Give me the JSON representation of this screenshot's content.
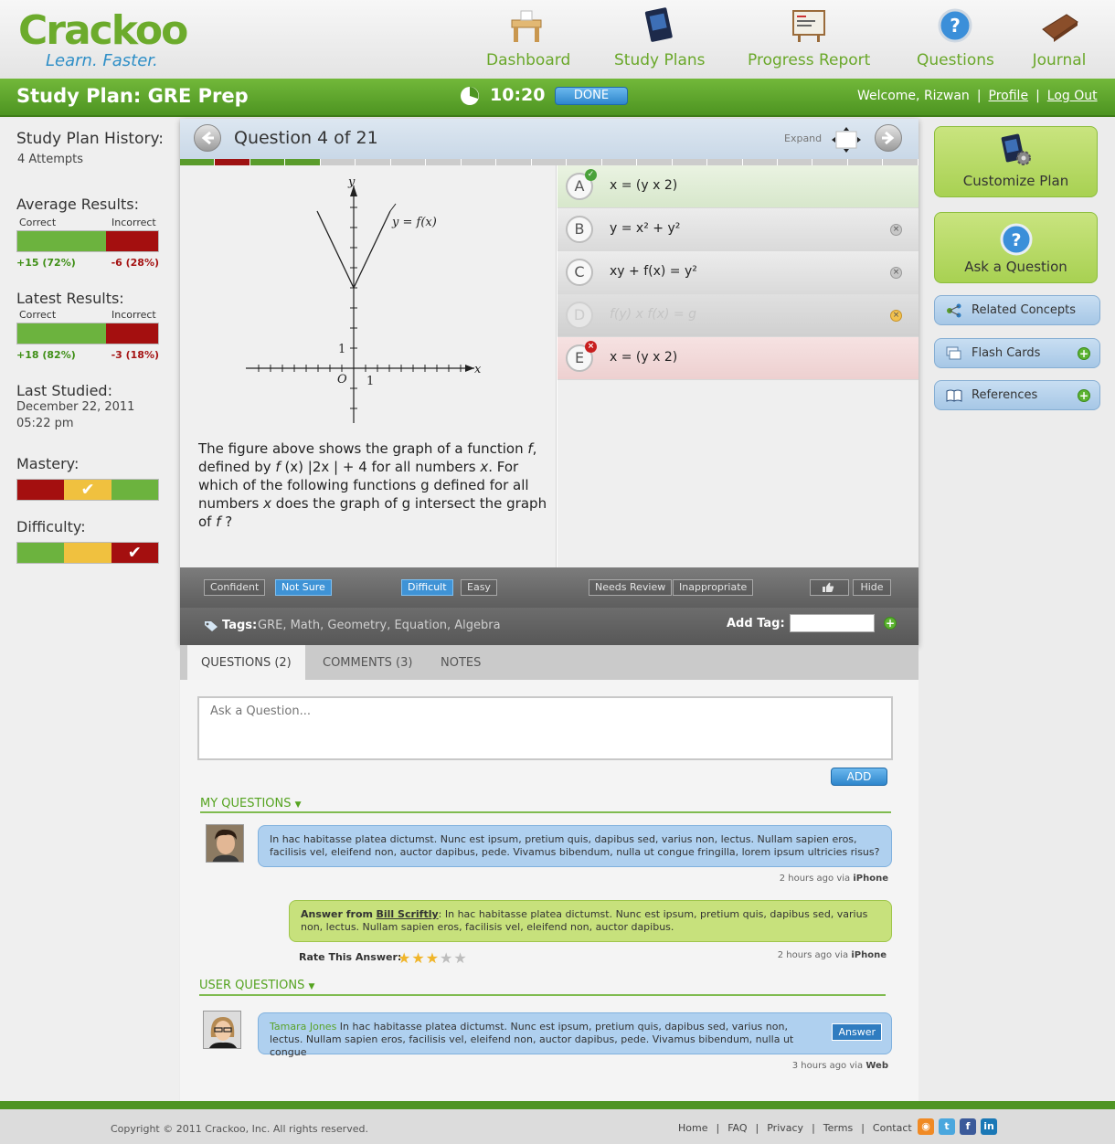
{
  "brand": {
    "name": "Crackoo",
    "tagline": "Learn. Faster.",
    "green": "#6cab2c",
    "blue": "#2f8fc7"
  },
  "nav": [
    {
      "label": "Dashboard",
      "icon": "desk-icon"
    },
    {
      "label": "Study Plans",
      "icon": "book-icon"
    },
    {
      "label": "Progress Report",
      "icon": "report-board-icon"
    },
    {
      "label": "Questions",
      "icon": "question-mark-icon"
    },
    {
      "label": "Journal",
      "icon": "journal-icon"
    }
  ],
  "topbar": {
    "plan_title": "Study Plan: GRE Prep",
    "timer": "10:20",
    "done_label": "DONE",
    "welcome": "Welcome, Rizwan",
    "profile": "Profile",
    "logout": "Log Out",
    "sep": "|"
  },
  "sidebar": {
    "history_title": "Study Plan History:",
    "attempts": "4 Attempts",
    "average_title": "Average Results:",
    "latest_title": "Latest Results:",
    "correct_label": "Correct",
    "incorrect_label": "Incorrect",
    "average": {
      "correct": "+15 (72%)",
      "incorrect": "-6 (28%)",
      "correct_fraction": 0.63
    },
    "latest": {
      "correct": "+18 (82%)",
      "incorrect": "-3 (18%)",
      "correct_fraction": 0.63
    },
    "last_studied_title": "Last Studied:",
    "last_studied_date": "December 22, 2011",
    "last_studied_time": "05:22 pm",
    "mastery_title": "Mastery:",
    "mastery_colors": [
      "#a40f0f",
      "#f0c13f",
      "#6cb33e"
    ],
    "mastery_checked": 2,
    "difficulty_title": "Difficulty:",
    "difficulty_colors": [
      "#6cb33e",
      "#f0c13f",
      "#a40f0f"
    ],
    "difficulty_checked": 3
  },
  "question": {
    "title": "Question 4 of 21",
    "expand": "Expand",
    "progress": [
      "g",
      "r",
      "g",
      "g",
      "n",
      "n",
      "n",
      "n",
      "n",
      "n",
      "n",
      "n",
      "n",
      "n",
      "n",
      "n",
      "n",
      "n",
      "n",
      "n",
      "n"
    ],
    "graph": {
      "y_axis_label": "y",
      "x_axis_label": "x",
      "curve_label": "y = f(x)",
      "origin_label": "O",
      "one_x": "1",
      "one_y": "1"
    },
    "text_parts": {
      "p1": "The figure above shows the graph of a function ",
      "f1": "f",
      "p2": ", defined by ",
      "f2": "f",
      "p3": " (x)  |2x | + 4 for all numbers ",
      "x1": "x",
      "p4": ". For which of the following functions g defined for all numbers ",
      "x2": "x",
      "p5": " does the graph of g intersect the graph of ",
      "f3": "f",
      "p6": " ?"
    },
    "answers": [
      {
        "letter": "A",
        "text": "x = (y x 2)",
        "state": "correct"
      },
      {
        "letter": "B",
        "text": "y = x² + y²",
        "state": "normal"
      },
      {
        "letter": "C",
        "text": "xy + f(x) = y²",
        "state": "normal"
      },
      {
        "letter": "D",
        "text": "f(y) x f(x) = g",
        "state": "disabled"
      },
      {
        "letter": "E",
        "text": "x = (y x 2)",
        "state": "wrong"
      }
    ]
  },
  "toolbar": {
    "confident": "Confident",
    "not_sure": "Not Sure",
    "difficult": "Difficult",
    "easy": "Easy",
    "needs_review": "Needs Review",
    "inappropriate": "Inappropriate",
    "hide": "Hide",
    "tags_label": "Tags:",
    "tags_value": "GRE, Math, Geometry, Equation, Algebra",
    "add_tag_label": "Add Tag:"
  },
  "tabs": [
    {
      "label": "QUESTIONS (2)",
      "active": true
    },
    {
      "label": "COMMENTS (3)",
      "active": false
    },
    {
      "label": "NOTES",
      "active": false
    }
  ],
  "discussion": {
    "ask_placeholder": "Ask a Question...",
    "add_label": "ADD",
    "my_questions_title": "MY QUESTIONS",
    "my_question_text": "In hac habitasse platea dictumst. Nunc est ipsum, pretium quis, dapibus sed, varius non, lectus. Nullam sapien eros, facilisis vel, eleifend non, auctor dapibus, pede. Vivamus bibendum, nulla ut congue fringilla, lorem ipsum ultricies risus?",
    "my_question_time": "2 hours ago via",
    "my_question_via": "iPhone",
    "answer_prefix": "Answer from",
    "answer_author": "Bill Scriftly",
    "answer_text": ": In hac habitasse platea dictumst. Nunc est ipsum, pretium quis, dapibus sed, varius non, lectus. Nullam sapien eros, facilisis vel, eleifend non, auctor dapibus.",
    "rate_label": "Rate This Answer:",
    "rating": 3,
    "rating_max": 5,
    "answer_time": "2 hours ago via",
    "answer_via": "iPhone",
    "user_questions_title": "USER QUESTIONS",
    "user_name": "Tamara Jones",
    "user_question_text": " In hac habitasse platea dictumst. Nunc est ipsum, pretium quis, dapibus sed, varius non, lectus. Nullam sapien eros, facilisis vel, eleifend non, auctor dapibus, pede. Vivamus bibendum, nulla ut congue",
    "answer_button": "Answer",
    "user_question_time": "3 hours ago via",
    "user_question_via": "Web"
  },
  "right": {
    "customize": "Customize Plan",
    "ask": "Ask a Question",
    "related": "Related Concepts",
    "flash": "Flash Cards",
    "references": "References"
  },
  "footer": {
    "copyright": "Copyright © 2011 Crackoo, Inc. All rights reserved.",
    "links": [
      "Home",
      "FAQ",
      "Privacy",
      "Terms",
      "Contact"
    ],
    "sep": "|",
    "social": [
      {
        "name": "rss-icon",
        "glyph": "◉",
        "color": "#f08a24"
      },
      {
        "name": "twitter-icon",
        "glyph": "t",
        "color": "#4aa7de"
      },
      {
        "name": "facebook-icon",
        "glyph": "f",
        "color": "#3b5a9a"
      },
      {
        "name": "linkedin-icon",
        "glyph": "in",
        "color": "#1a78b6"
      }
    ]
  }
}
